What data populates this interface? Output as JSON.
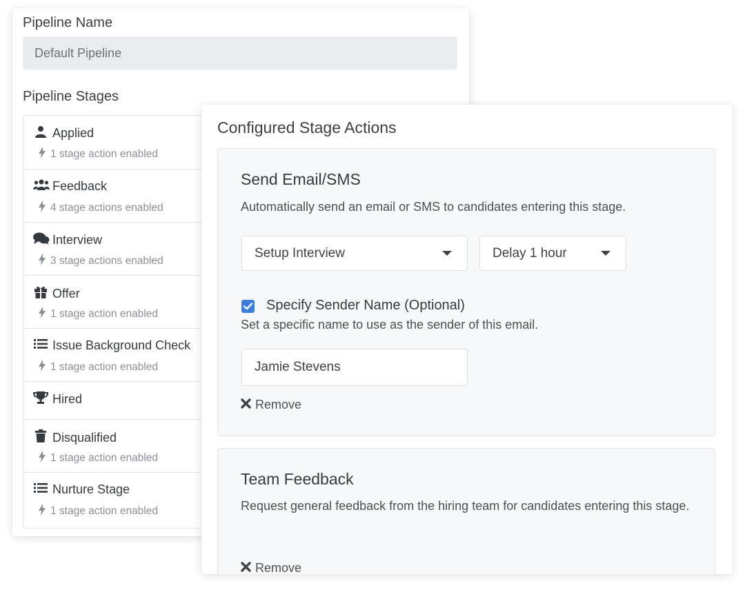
{
  "pipeline": {
    "name_label": "Pipeline Name",
    "name_value": "Default Pipeline",
    "stages_label": "Pipeline Stages",
    "stages": [
      {
        "title": "Applied",
        "icon": "user-icon",
        "sub": "1 stage action enabled"
      },
      {
        "title": "Feedback",
        "icon": "users-icon",
        "sub": "4 stage actions enabled"
      },
      {
        "title": "Interview",
        "icon": "comments-icon",
        "sub": "3 stage actions enabled"
      },
      {
        "title": "Offer",
        "icon": "gift-icon",
        "sub": "1 stage action enabled"
      },
      {
        "title": "Issue Background Check",
        "icon": "list-icon",
        "sub": "1 stage action enabled"
      },
      {
        "title": "Hired",
        "icon": "trophy-icon",
        "sub": ""
      },
      {
        "title": "Disqualified",
        "icon": "trash-icon",
        "sub": "1 stage action enabled"
      },
      {
        "title": "Nurture Stage",
        "icon": "list-icon",
        "sub": "1 stage action enabled"
      }
    ]
  },
  "actions": {
    "title": "Configured Stage Actions",
    "email": {
      "title": "Send Email/SMS",
      "description": "Automatically send an email or SMS to candidates entering this stage.",
      "template_value": "Setup Interview",
      "delay_value": "Delay 1 hour",
      "sender_checkbox_label": "Specify Sender Name (Optional)",
      "sender_checked": true,
      "sender_description": "Set a specific name to use as the sender of this email.",
      "sender_value": "Jamie Stevens",
      "remove_label": "Remove"
    },
    "feedback": {
      "title": "Team Feedback",
      "description": "Request general feedback from the hiring team for candidates entering this stage.",
      "remove_label": "Remove"
    }
  },
  "colors": {
    "accent": "#3b7ddd",
    "panel_bg": "#f7f8f9",
    "input_disabled_bg": "#e9ecef"
  }
}
